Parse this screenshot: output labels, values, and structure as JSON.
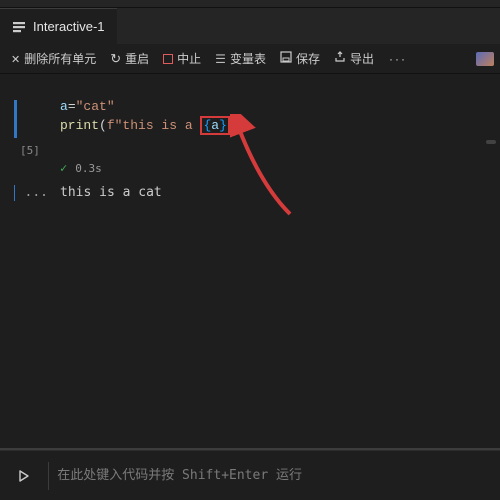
{
  "tab": {
    "title": "Interactive-1"
  },
  "toolbar": {
    "clear": "删除所有单元",
    "restart": "重启",
    "interrupt": "中止",
    "variables": "变量表",
    "save": "保存",
    "export": "导出",
    "more": "···"
  },
  "cell": {
    "exec_count": "[5]",
    "code": {
      "line1_var": "a",
      "line1_op": "=",
      "line1_str": "\"cat\"",
      "line2_fn": "print",
      "line2_prefix": "f\"this is a ",
      "line2_lbrace": "{",
      "line2_fvar": "a",
      "line2_rbrace": "}",
      "line2_suffix": "\""
    },
    "status": {
      "check": "✓",
      "duration": "0.3s"
    },
    "output_prefix": "...",
    "output_text": "this is a cat"
  },
  "input": {
    "placeholder": "在此处键入代码并按 Shift+Enter 运行"
  }
}
